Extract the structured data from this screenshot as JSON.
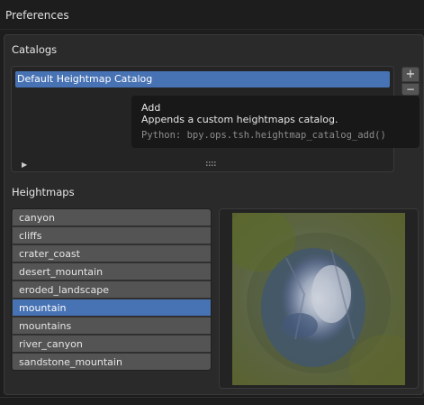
{
  "header": {
    "title": "Preferences"
  },
  "catalogs": {
    "label": "Catalogs",
    "items": [
      "Default Heightmap Catalog"
    ],
    "add_label": "+",
    "remove_label": "−"
  },
  "tooltip": {
    "title": "Add",
    "description": "Appends a custom heightmaps catalog.",
    "python": "Python: bpy.ops.tsh.heightmap_catalog_add()"
  },
  "heightmaps": {
    "label": "Heightmaps",
    "items": [
      "canyon",
      "cliffs",
      "crater_coast",
      "desert_mountain",
      "eroded_landscape",
      "mountain",
      "mountains",
      "river_canyon",
      "sandstone_mountain"
    ],
    "selected": "mountain"
  },
  "colors": {
    "accent": "#4772b3",
    "panel": "#2a2a2a",
    "background": "#1d1d1d"
  },
  "icons": {
    "expand": "triangle-right-icon",
    "grip": "drag-grip-icon"
  }
}
